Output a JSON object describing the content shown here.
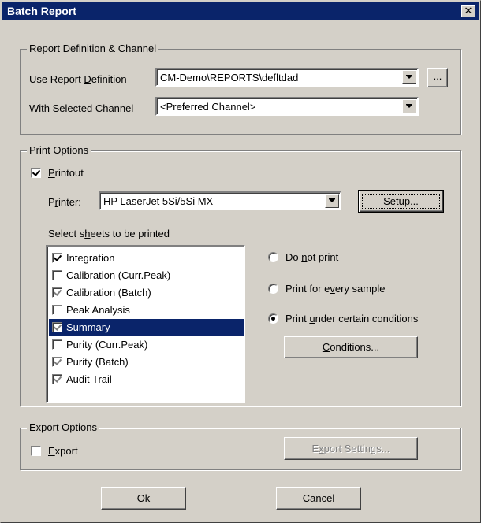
{
  "window": {
    "title": "Batch Report",
    "close_glyph": "✕"
  },
  "report_group": {
    "title": "Report Definition & Channel",
    "definition_label_pre": "Use Report ",
    "definition_label_key": "D",
    "definition_label_post": "efinition",
    "definition_value": "CM-Demo\\REPORTS\\defltdad",
    "browse_label": "...",
    "channel_label_pre": "With Selected ",
    "channel_label_key": "C",
    "channel_label_post": "hannel",
    "channel_value": "<Preferred Channel>"
  },
  "print_group": {
    "title": "Print Options",
    "printout_pre": "",
    "printout_key": "P",
    "printout_post": "rintout",
    "printout_checked": true,
    "printer_label_pre": "P",
    "printer_label_key": "r",
    "printer_label_post": "inter:",
    "printer_value": "HP LaserJet 5Si/5Si MX",
    "setup_pre": "",
    "setup_key": "S",
    "setup_post": "etup...",
    "sheets_label_pre": "Select s",
    "sheets_label_key": "h",
    "sheets_label_post": "eets to be printed",
    "sheets": [
      {
        "label": "Integration",
        "state": "checked"
      },
      {
        "label": "Calibration (Curr.Peak)",
        "state": "unchecked"
      },
      {
        "label": "Calibration (Batch)",
        "state": "grey-checked"
      },
      {
        "label": "Peak Analysis",
        "state": "unchecked"
      },
      {
        "label": "Summary",
        "state": "grey-checked",
        "selected": true
      },
      {
        "label": "Purity (Curr.Peak)",
        "state": "unchecked"
      },
      {
        "label": "Purity (Batch)",
        "state": "grey-checked"
      },
      {
        "label": "Audit Trail",
        "state": "grey-checked"
      }
    ],
    "radio_no_print_pre": "Do ",
    "radio_no_print_key": "n",
    "radio_no_print_post": "ot print",
    "radio_every_pre": "Print for e",
    "radio_every_key": "v",
    "radio_every_post": "ery sample",
    "radio_cond_pre": "Print ",
    "radio_cond_key": "u",
    "radio_cond_post": "nder certain conditions",
    "selected_radio": "conditions",
    "conditions_pre": "",
    "conditions_key": "C",
    "conditions_post": "onditions..."
  },
  "export_group": {
    "title": "Export Options",
    "export_pre": "",
    "export_key": "E",
    "export_post": "xport",
    "export_checked": false,
    "settings_pre": "E",
    "settings_key": "x",
    "settings_post": "port Settings..."
  },
  "buttons": {
    "ok": "Ok",
    "cancel": "Cancel"
  }
}
